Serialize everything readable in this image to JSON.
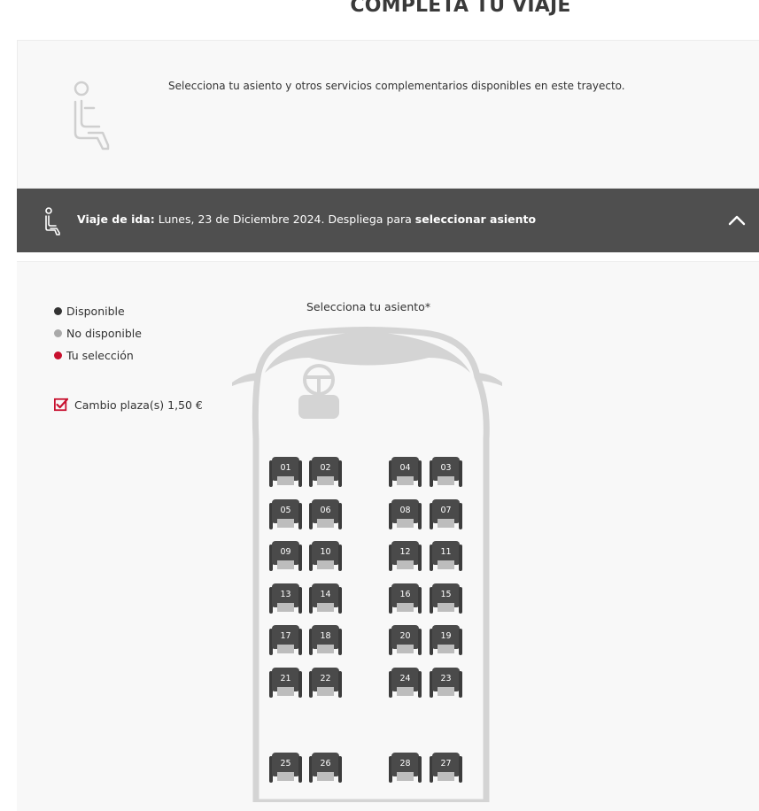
{
  "page": {
    "title": "COMPLETA TU VIAJE"
  },
  "intro": {
    "text": "Selecciona tu asiento y otros servicios complementarios disponibles en este trayecto.",
    "icon": "seat-icon"
  },
  "trip": {
    "label": "Viaje de ida:",
    "date_text": " Lunes, 23 de Diciembre 2024. Despliega para ",
    "action_text": "seleccionar asiento",
    "icon": "seat-icon",
    "toggle_icon": "chevron-up-icon"
  },
  "legend": {
    "items": [
      {
        "label": "Disponible",
        "color": "#333333"
      },
      {
        "label": "No disponible",
        "color": "#a9a9a9"
      },
      {
        "label": "Tu selección",
        "color": "#c8102e"
      }
    ]
  },
  "change_seat": {
    "label": "Cambio plaza(s) 1,50 €",
    "checked": true,
    "color": "#c8102e"
  },
  "seat_map": {
    "title": "Selecciona tu asiento*",
    "rows": [
      [
        "01",
        "02",
        "04",
        "03"
      ],
      [
        "05",
        "06",
        "08",
        "07"
      ],
      [
        "09",
        "10",
        "12",
        "11"
      ],
      [
        "13",
        "14",
        "16",
        "15"
      ],
      [
        "17",
        "18",
        "20",
        "19"
      ],
      [
        "21",
        "22",
        "24",
        "23"
      ],
      [
        "25",
        "26",
        "28",
        "27"
      ]
    ]
  }
}
